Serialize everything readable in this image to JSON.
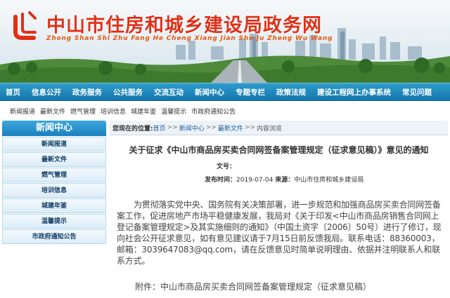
{
  "header": {
    "title": "中山市住房和城乡建设局政务网",
    "pinyin": "Zhong Shan Shi Zhu Fang He Cheng Xiang Jian She Ju Zheng Wu Wang",
    "logo_icon": "zhongshan-housing-logo"
  },
  "nav": {
    "items": [
      "首页",
      "信息公开",
      "政务服务",
      "公共服务",
      "交流互动",
      "新闻中心",
      "专题专栏",
      "政策法规",
      "建设工程网上办事系统",
      "常见问题"
    ]
  },
  "subnav": {
    "items": [
      "新闻报道",
      "最新文件",
      "燃气管理",
      "培训信息",
      "城建年鉴",
      "温馨提示",
      "市政府通知公告"
    ]
  },
  "sidebar": {
    "heading": "新闻中心",
    "items": [
      "新闻报道",
      "最新文件",
      "燃气管理",
      "培训信息",
      "城建年鉴",
      "温馨提示",
      "市政府通知公告"
    ]
  },
  "breadcrumb": {
    "label": "您现在的位置:",
    "home": "首页",
    "section": "新闻中心",
    "category": "最新文件",
    "current": "内容浏览",
    "separator": ">>"
  },
  "article": {
    "title": "关于征求《中山市商品房买卖合同网签备案管理规定（征求意见稿）》意见的通知",
    "doc_no_label": "文号：",
    "date_label": "发布时间：",
    "date": "2019-07-04",
    "source_label": "来源：",
    "source": "中山市住房和城乡建设局",
    "body": "为贯彻落实党中央、国务院有关决策部署，进一步规范和加强商品房买卖合同网签备案工作，促进房地产市场平稳健康发展，我局对《关于印发<中山市商品房销售合同网上登记备案管理规定>及其实施细则的通知》（中国土资字〔2006〕50号）进行了修订，现向社会公开征求意见，如有意见建议请于7月15日前反馈我局。联系电话：88360003，邮箱：3039647083@qq.com，请在反馈意见时简单说明理由、依据并注明联系人和联系方式。",
    "attachment": "附件：中山市商品房买卖合同网签备案管理规定（征求意见稿）"
  },
  "colors": {
    "nav_bg": "#1d84ba",
    "title_red": "#e03018",
    "sidebar_head": "#2690cc",
    "link": "#1a5f9e"
  }
}
